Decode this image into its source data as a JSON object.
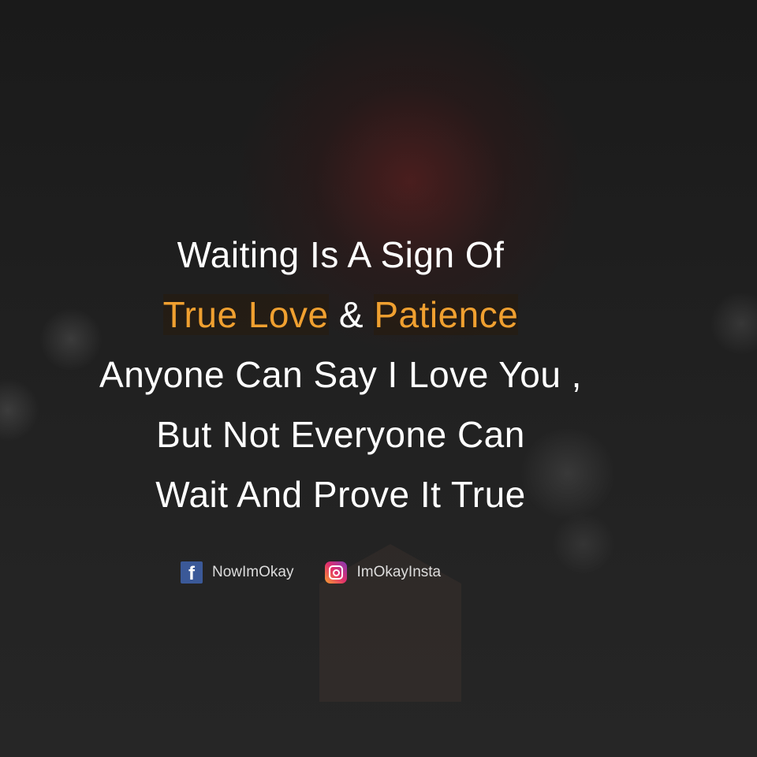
{
  "quote": {
    "line1": "Waiting Is A Sign Of",
    "line2_a": "True Love",
    "line2_b": " & ",
    "line2_c": "Patience",
    "line3": "Anyone Can Say I Love You ,",
    "line4": "But Not Everyone Can",
    "line5": "Wait And Prove It True"
  },
  "accent_color": "#f0a030",
  "social": {
    "facebook": {
      "icon": "facebook-icon",
      "handle": "NowImOkay"
    },
    "instagram": {
      "icon": "instagram-icon",
      "handle": "ImOkayInsta"
    }
  }
}
